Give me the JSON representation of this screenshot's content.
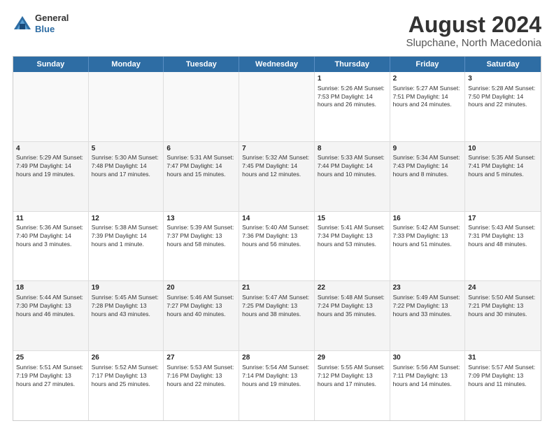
{
  "header": {
    "logo_line1": "General",
    "logo_line2": "Blue",
    "title": "August 2024",
    "location": "Slupchane, North Macedonia"
  },
  "weekdays": [
    "Sunday",
    "Monday",
    "Tuesday",
    "Wednesday",
    "Thursday",
    "Friday",
    "Saturday"
  ],
  "weeks": [
    [
      {
        "day": "",
        "text": "",
        "empty": true
      },
      {
        "day": "",
        "text": "",
        "empty": true
      },
      {
        "day": "",
        "text": "",
        "empty": true
      },
      {
        "day": "",
        "text": "",
        "empty": true
      },
      {
        "day": "1",
        "text": "Sunrise: 5:26 AM\nSunset: 7:53 PM\nDaylight: 14 hours\nand 26 minutes."
      },
      {
        "day": "2",
        "text": "Sunrise: 5:27 AM\nSunset: 7:51 PM\nDaylight: 14 hours\nand 24 minutes."
      },
      {
        "day": "3",
        "text": "Sunrise: 5:28 AM\nSunset: 7:50 PM\nDaylight: 14 hours\nand 22 minutes."
      }
    ],
    [
      {
        "day": "4",
        "text": "Sunrise: 5:29 AM\nSunset: 7:49 PM\nDaylight: 14 hours\nand 19 minutes."
      },
      {
        "day": "5",
        "text": "Sunrise: 5:30 AM\nSunset: 7:48 PM\nDaylight: 14 hours\nand 17 minutes."
      },
      {
        "day": "6",
        "text": "Sunrise: 5:31 AM\nSunset: 7:47 PM\nDaylight: 14 hours\nand 15 minutes."
      },
      {
        "day": "7",
        "text": "Sunrise: 5:32 AM\nSunset: 7:45 PM\nDaylight: 14 hours\nand 12 minutes."
      },
      {
        "day": "8",
        "text": "Sunrise: 5:33 AM\nSunset: 7:44 PM\nDaylight: 14 hours\nand 10 minutes."
      },
      {
        "day": "9",
        "text": "Sunrise: 5:34 AM\nSunset: 7:43 PM\nDaylight: 14 hours\nand 8 minutes."
      },
      {
        "day": "10",
        "text": "Sunrise: 5:35 AM\nSunset: 7:41 PM\nDaylight: 14 hours\nand 5 minutes."
      }
    ],
    [
      {
        "day": "11",
        "text": "Sunrise: 5:36 AM\nSunset: 7:40 PM\nDaylight: 14 hours\nand 3 minutes."
      },
      {
        "day": "12",
        "text": "Sunrise: 5:38 AM\nSunset: 7:39 PM\nDaylight: 14 hours\nand 1 minute."
      },
      {
        "day": "13",
        "text": "Sunrise: 5:39 AM\nSunset: 7:37 PM\nDaylight: 13 hours\nand 58 minutes."
      },
      {
        "day": "14",
        "text": "Sunrise: 5:40 AM\nSunset: 7:36 PM\nDaylight: 13 hours\nand 56 minutes."
      },
      {
        "day": "15",
        "text": "Sunrise: 5:41 AM\nSunset: 7:34 PM\nDaylight: 13 hours\nand 53 minutes."
      },
      {
        "day": "16",
        "text": "Sunrise: 5:42 AM\nSunset: 7:33 PM\nDaylight: 13 hours\nand 51 minutes."
      },
      {
        "day": "17",
        "text": "Sunrise: 5:43 AM\nSunset: 7:31 PM\nDaylight: 13 hours\nand 48 minutes."
      }
    ],
    [
      {
        "day": "18",
        "text": "Sunrise: 5:44 AM\nSunset: 7:30 PM\nDaylight: 13 hours\nand 46 minutes."
      },
      {
        "day": "19",
        "text": "Sunrise: 5:45 AM\nSunset: 7:28 PM\nDaylight: 13 hours\nand 43 minutes."
      },
      {
        "day": "20",
        "text": "Sunrise: 5:46 AM\nSunset: 7:27 PM\nDaylight: 13 hours\nand 40 minutes."
      },
      {
        "day": "21",
        "text": "Sunrise: 5:47 AM\nSunset: 7:25 PM\nDaylight: 13 hours\nand 38 minutes."
      },
      {
        "day": "22",
        "text": "Sunrise: 5:48 AM\nSunset: 7:24 PM\nDaylight: 13 hours\nand 35 minutes."
      },
      {
        "day": "23",
        "text": "Sunrise: 5:49 AM\nSunset: 7:22 PM\nDaylight: 13 hours\nand 33 minutes."
      },
      {
        "day": "24",
        "text": "Sunrise: 5:50 AM\nSunset: 7:21 PM\nDaylight: 13 hours\nand 30 minutes."
      }
    ],
    [
      {
        "day": "25",
        "text": "Sunrise: 5:51 AM\nSunset: 7:19 PM\nDaylight: 13 hours\nand 27 minutes."
      },
      {
        "day": "26",
        "text": "Sunrise: 5:52 AM\nSunset: 7:17 PM\nDaylight: 13 hours\nand 25 minutes."
      },
      {
        "day": "27",
        "text": "Sunrise: 5:53 AM\nSunset: 7:16 PM\nDaylight: 13 hours\nand 22 minutes."
      },
      {
        "day": "28",
        "text": "Sunrise: 5:54 AM\nSunset: 7:14 PM\nDaylight: 13 hours\nand 19 minutes."
      },
      {
        "day": "29",
        "text": "Sunrise: 5:55 AM\nSunset: 7:12 PM\nDaylight: 13 hours\nand 17 minutes."
      },
      {
        "day": "30",
        "text": "Sunrise: 5:56 AM\nSunset: 7:11 PM\nDaylight: 13 hours\nand 14 minutes."
      },
      {
        "day": "31",
        "text": "Sunrise: 5:57 AM\nSunset: 7:09 PM\nDaylight: 13 hours\nand 11 minutes."
      }
    ]
  ]
}
